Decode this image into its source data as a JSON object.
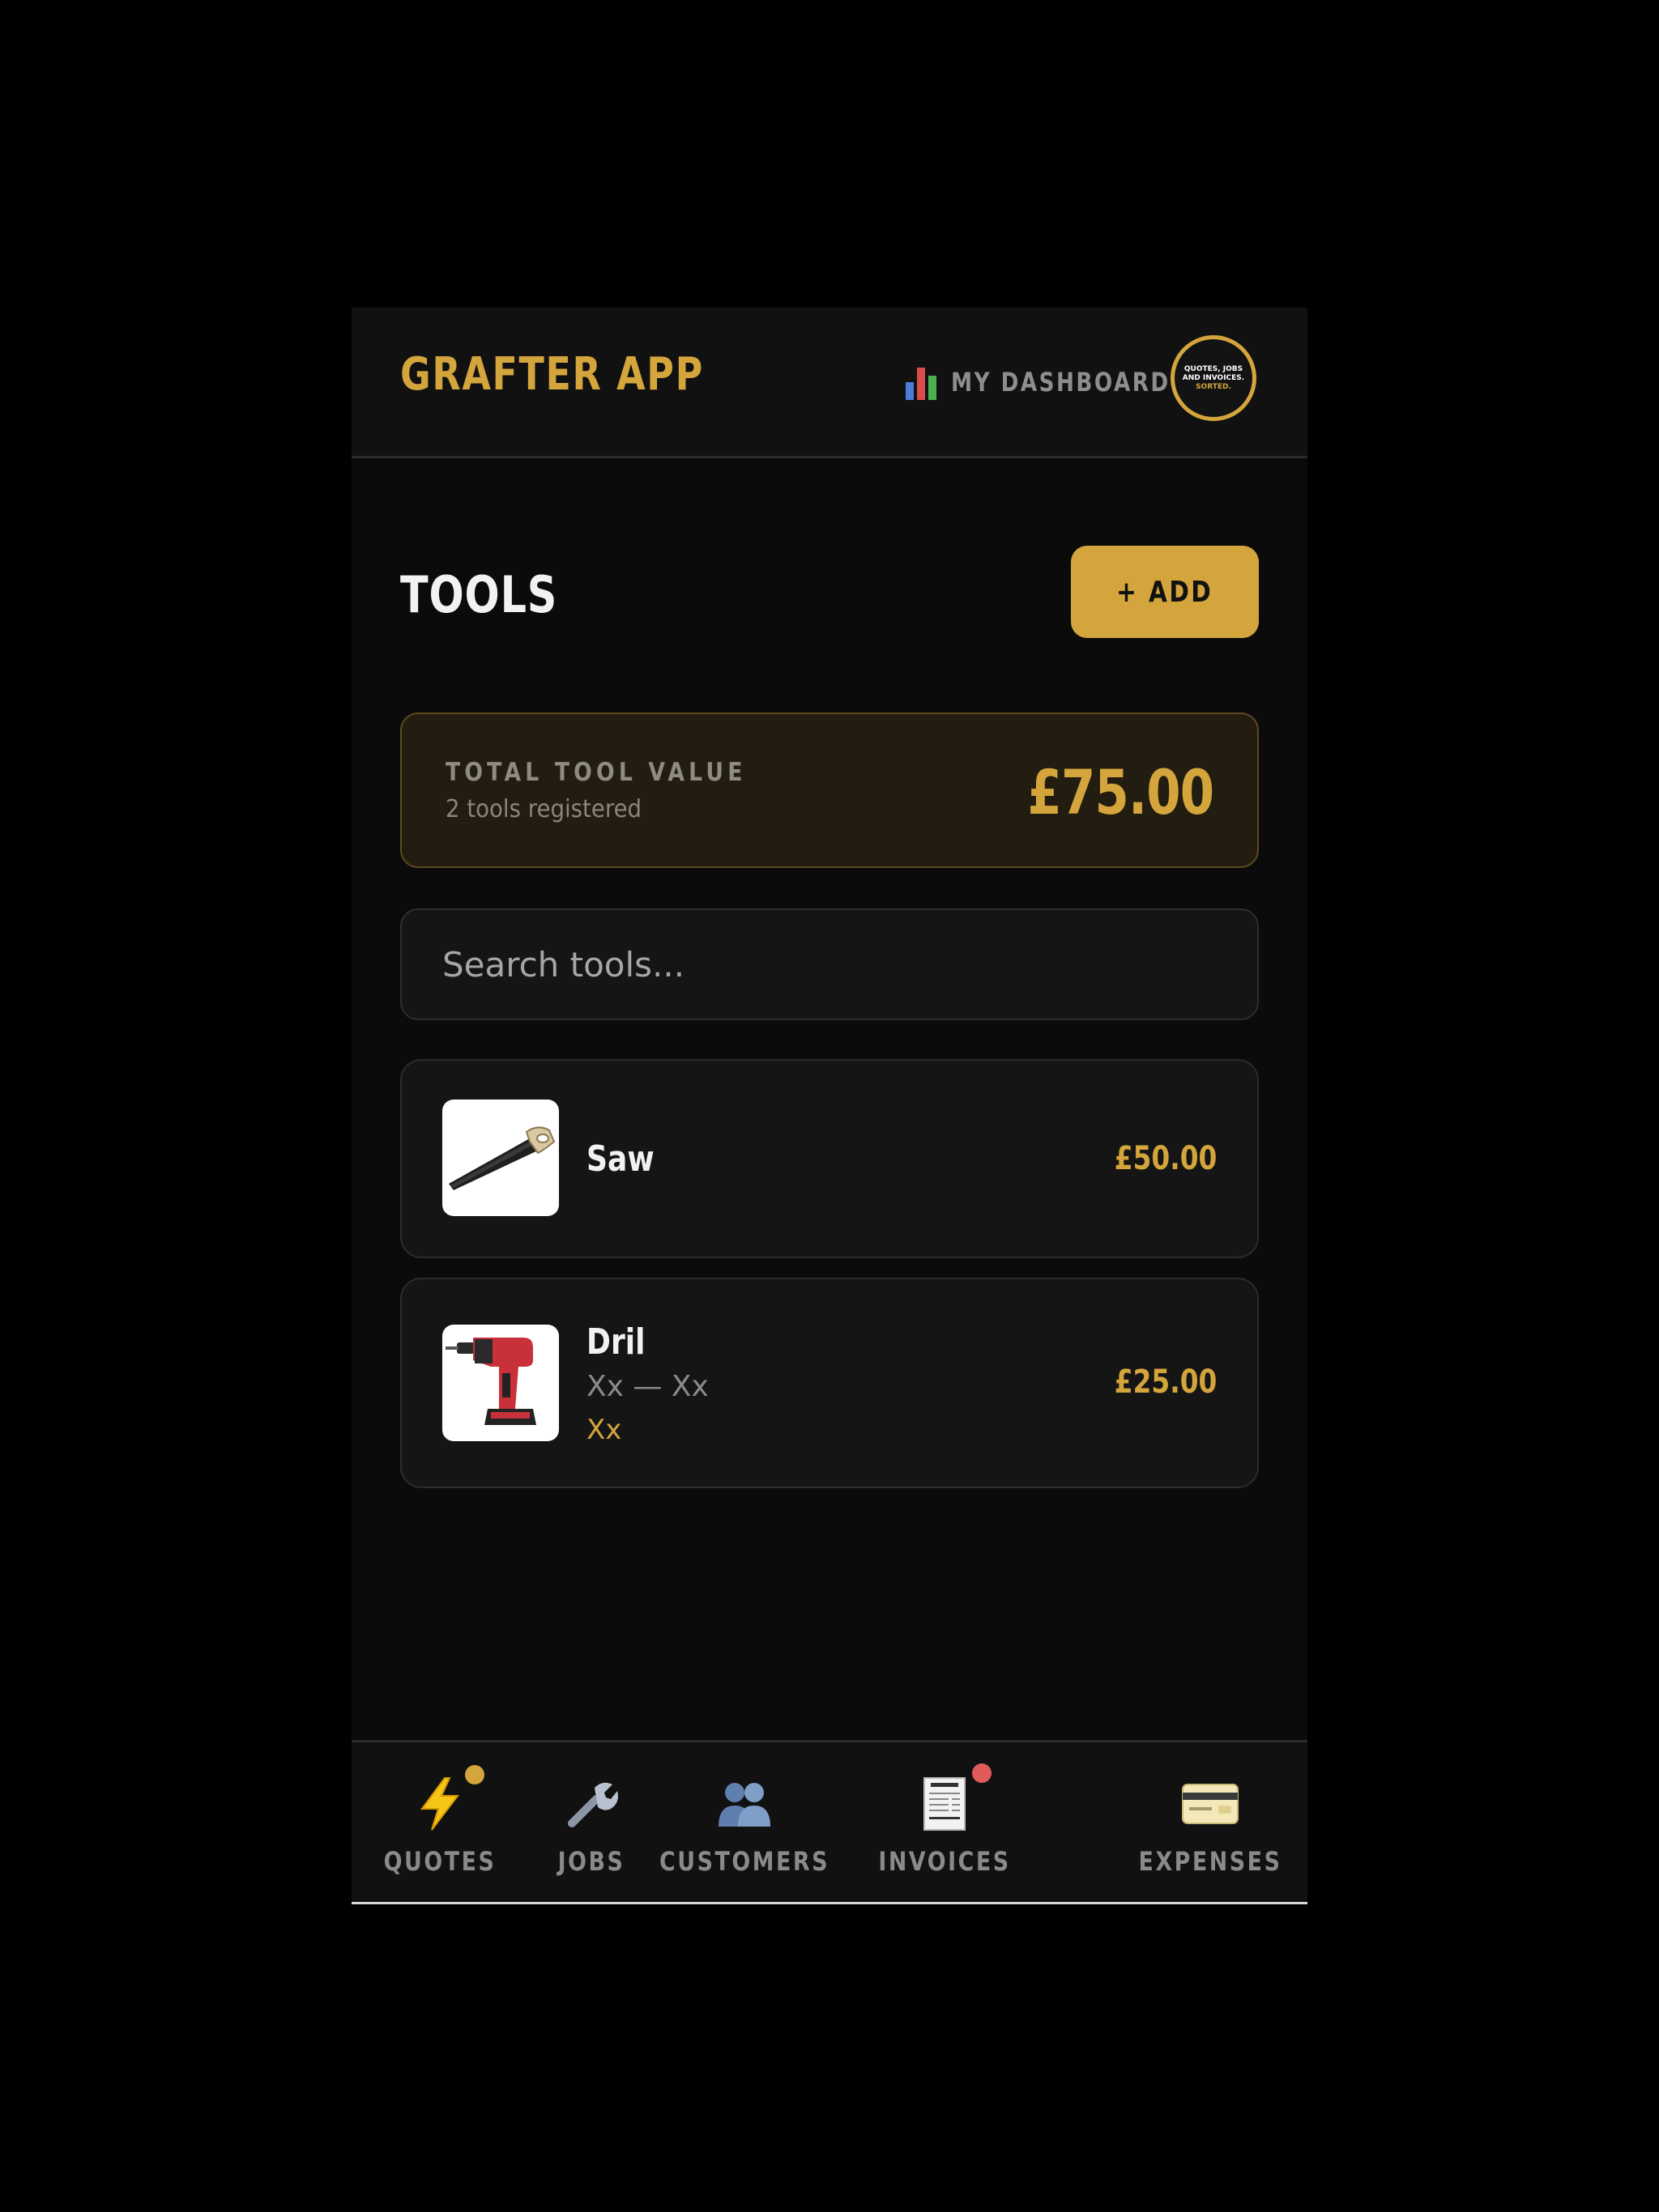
{
  "header": {
    "brand": "GRAFTER APP",
    "dashboard_label": "MY DASHBOARD",
    "avatar": {
      "line1": "QUOTES, JOBS",
      "line2": "AND INVOICES.",
      "line3": "SORTED."
    }
  },
  "page": {
    "title": "TOOLS",
    "add_label": "+ ADD"
  },
  "summary": {
    "label": "TOTAL TOOL VALUE",
    "sub": "2 tools registered",
    "value": "£75.00"
  },
  "search": {
    "placeholder": "Search tools..."
  },
  "tools": [
    {
      "name": "Saw",
      "price": "£50.00",
      "image_icon": "saw-icon"
    },
    {
      "name": "Dril",
      "meta": "Xx — Xx",
      "tag": "Xx",
      "price": "£25.00",
      "image_icon": "drill-icon"
    }
  ],
  "nav": [
    {
      "label": "QUOTES",
      "icon": "lightning-icon",
      "badge_color": "#d4a53c"
    },
    {
      "label": "JOBS",
      "icon": "wrench-icon"
    },
    {
      "label": "CUSTOMERS",
      "icon": "people-icon"
    },
    {
      "label": "INVOICES",
      "icon": "receipt-icon",
      "badge_color": "#e05a5a"
    },
    {
      "label": "EXPENSES",
      "icon": "card-icon"
    }
  ],
  "colors": {
    "accent": "#d4a53c",
    "background": "#0b0b0b",
    "surface": "#151515",
    "alert": "#e05a5a"
  }
}
